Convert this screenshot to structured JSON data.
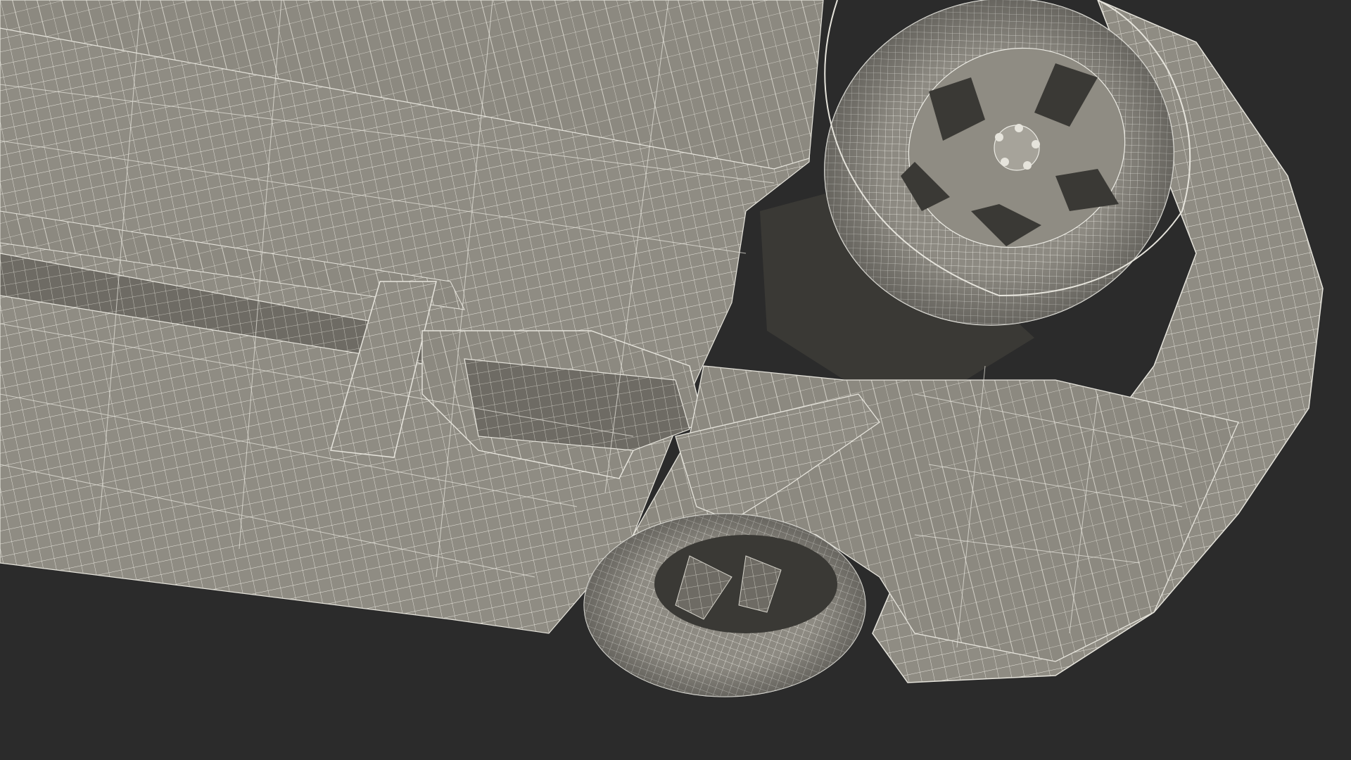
{
  "scene": {
    "background_color": "#2b2b2b",
    "mesh_fill_color": "#8f8c83",
    "mesh_shadow_color": "#6e6b64",
    "mesh_highlight_color": "#a6a39a",
    "wire_color": "#e6e4dc",
    "dark_cavity_color": "#3a3935",
    "icon": "wireframe-car-underbody"
  }
}
